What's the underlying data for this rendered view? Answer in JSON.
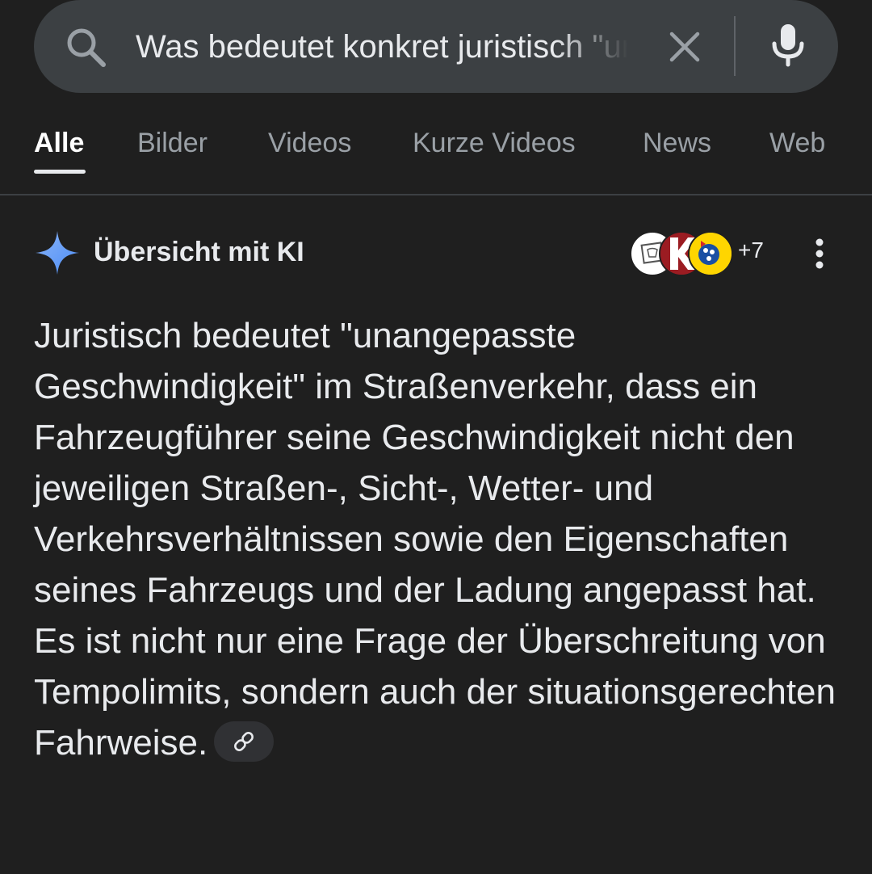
{
  "search": {
    "query": "Was bedeutet konkret juristisch \"unangepasste Geschwindigkeit\""
  },
  "tabs": [
    {
      "label": "Alle",
      "active": true
    },
    {
      "label": "Bilder"
    },
    {
      "label": "Videos"
    },
    {
      "label": "Kurze Videos"
    },
    {
      "label": "News"
    },
    {
      "label": "Web"
    }
  ],
  "ai_overview": {
    "title": "Übersicht mit KI",
    "sources_more": "+7",
    "body": "Juristisch bedeutet \"unangepasste Geschwindigkeit\" im Straßenverkehr, dass ein Fahrzeugführer seine Geschwindigkeit nicht den jeweiligen Straßen-, Sicht-, Wetter- und Verkehrsverhältnissen sowie den Eigenschaften seines Fahrzeugs und der Ladung angepasst hat. Es ist nicht nur eine Frage der Überschreitung von Tempolimits, sondern auch der situationsgerechten Fahrweise."
  },
  "icons": [
    "search-icon",
    "close-icon",
    "mic-icon",
    "sparkle-icon",
    "more-vert-icon",
    "link-icon"
  ],
  "colors": {
    "background": "#1f1f1f",
    "search_bar": "#3c4043",
    "text_primary": "#e8eaed",
    "text_secondary": "#9aa0a6",
    "sparkle_blue": "#4c8df6"
  }
}
